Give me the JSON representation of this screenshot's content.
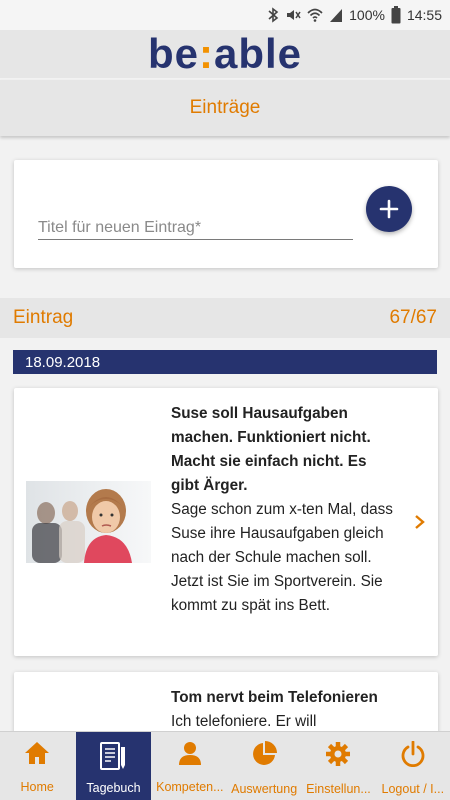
{
  "status_bar": {
    "battery_text": "100%",
    "time": "14:55",
    "icons": [
      "bluetooth-icon",
      "mute-icon",
      "wifi-icon",
      "signal-icon",
      "battery-icon"
    ]
  },
  "logo": {
    "part1": "be",
    "colon": ":",
    "part2": "able"
  },
  "header": {
    "title": "Einträge"
  },
  "new_entry": {
    "placeholder": "Titel für neuen Eintrag*",
    "value": "",
    "add_icon": "plus-icon"
  },
  "section": {
    "label": "Eintrag",
    "count": "67/67"
  },
  "date_group": {
    "date": "18.09.2018"
  },
  "entries": [
    {
      "title": "Suse soll Hausaufgaben machen. Funktioniert nicht. Macht sie einfach nicht. Es gibt Ärger.",
      "body": "Sage schon zum x-ten Mal, dass Suse ihre Hausaufgaben gleich nach der Schule machen soll. Jetzt ist Sie im Sportverein. Sie kommt zu spät ins Bett.",
      "has_image": true,
      "chevron_icon": "chevron-right-icon"
    },
    {
      "title": "Tom nervt beim Telefonieren",
      "body": "Ich telefoniere. Er will",
      "has_image": false
    }
  ],
  "bottom_nav": [
    {
      "label": "Home",
      "icon": "home-icon",
      "active": false
    },
    {
      "label": "Tagebuch",
      "icon": "diary-icon",
      "active": true
    },
    {
      "label": "Kompeten...",
      "icon": "person-icon",
      "active": false
    },
    {
      "label": "Auswertung",
      "icon": "pie-chart-icon",
      "active": false
    },
    {
      "label": "Einstellun...",
      "icon": "gear-icon",
      "active": false
    },
    {
      "label": "Logout / I...",
      "icon": "power-icon",
      "active": false
    }
  ],
  "colors": {
    "brand_navy": "#26336f",
    "accent_orange": "#e07b00",
    "bar_gray": "#e6e6e6"
  }
}
